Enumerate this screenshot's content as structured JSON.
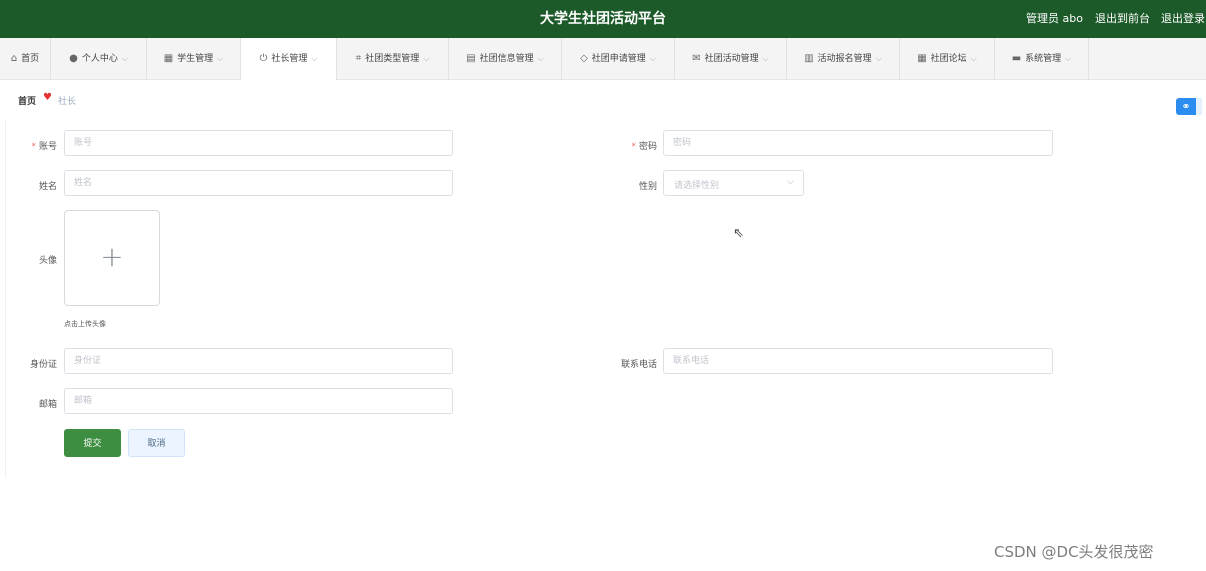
{
  "header": {
    "title": "大学生社团活动平台",
    "admin_label": "管理员 abo",
    "back_front": "退出到前台",
    "logout": "退出登录"
  },
  "nav": {
    "items": [
      {
        "icon": "home-icon",
        "glyph": "⌂",
        "label": "首页",
        "dropdown": false
      },
      {
        "icon": "person-icon",
        "glyph": "👤",
        "label": "个人中心",
        "dropdown": true
      },
      {
        "icon": "grid-icon",
        "glyph": "▦",
        "label": "学生管理",
        "dropdown": true
      },
      {
        "icon": "power-icon",
        "glyph": "⏻",
        "label": "社长管理",
        "dropdown": true,
        "active": true
      },
      {
        "icon": "crop-icon",
        "glyph": "⌗",
        "label": "社团类型管理",
        "dropdown": true
      },
      {
        "icon": "trash-icon",
        "glyph": "▤",
        "label": "社团信息管理",
        "dropdown": true
      },
      {
        "icon": "compass-icon",
        "glyph": "◇",
        "label": "社团申请管理",
        "dropdown": true
      },
      {
        "icon": "mail-icon",
        "glyph": "✉",
        "label": "社团活动管理",
        "dropdown": true
      },
      {
        "icon": "bar-chart-icon",
        "glyph": "▥",
        "label": "活动报名管理",
        "dropdown": true
      },
      {
        "icon": "table-icon",
        "glyph": "▦",
        "label": "社团论坛",
        "dropdown": true
      },
      {
        "icon": "menu-icon",
        "glyph": "▬",
        "label": "系统管理",
        "dropdown": true
      }
    ]
  },
  "breadcrumb": {
    "home": "首页",
    "separator_icon": "heart-icon",
    "current": "社长"
  },
  "form": {
    "account": {
      "label": "账号",
      "required": true,
      "placeholder": "账号",
      "value": ""
    },
    "password": {
      "label": "密码",
      "required": true,
      "placeholder": "密码",
      "value": ""
    },
    "name": {
      "label": "姓名",
      "placeholder": "姓名",
      "value": ""
    },
    "gender": {
      "label": "性别",
      "placeholder": "请选择性别"
    },
    "avatar": {
      "label": "头像",
      "upload_tip": "点击上传头像"
    },
    "id_card": {
      "label": "身份证",
      "placeholder": "身份证",
      "value": ""
    },
    "phone": {
      "label": "联系电话",
      "placeholder": "联系电话",
      "value": ""
    },
    "email": {
      "label": "邮箱",
      "placeholder": "邮箱",
      "value": ""
    },
    "submit_label": "提交",
    "cancel_label": "取消"
  },
  "watermark": "CSDN @DC头发很茂密",
  "colors": {
    "header_bg": "#1c5a2a",
    "submit_bg": "#3e8e41",
    "required": "#f56c6c",
    "heart": "#e83333",
    "float_button": "#2c8cf0"
  }
}
